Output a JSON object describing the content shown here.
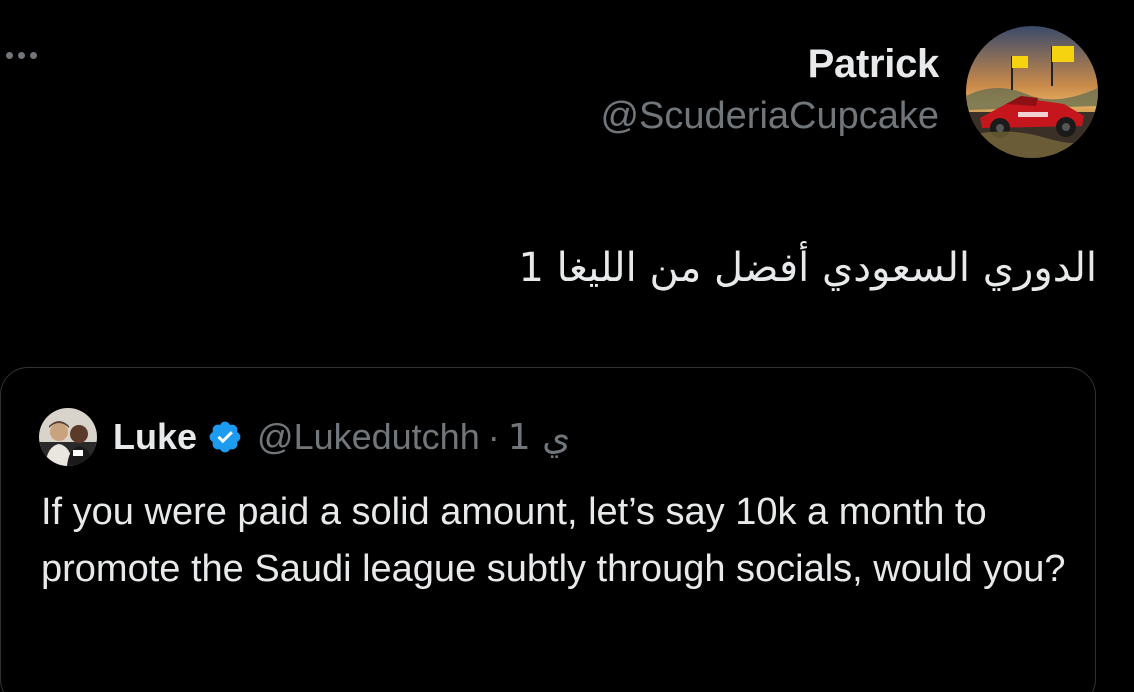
{
  "tweet": {
    "author": {
      "display_name": "Patrick",
      "handle": "@ScuderiaCupcake",
      "avatar_icon": "ferrari-car-avatar"
    },
    "text": "الدوري السعودي أفضل من الليغا 1",
    "more_icon": "ellipsis-icon"
  },
  "quoted_tweet": {
    "author": {
      "display_name": "Luke",
      "handle": "@Lukedutchh",
      "verified": true,
      "avatar_icon": "two-people-photo-avatar"
    },
    "separator": "·",
    "timestamp": "1 ي",
    "text": "If you were paid a solid amount, let’s say 10k a month to promote the Saudi league subtly through socials, would you?"
  },
  "colors": {
    "background": "#000000",
    "text_primary": "#e7e9ea",
    "text_secondary": "#71767b",
    "border": "#2f3336",
    "verified_blue": "#1d9bf0"
  }
}
